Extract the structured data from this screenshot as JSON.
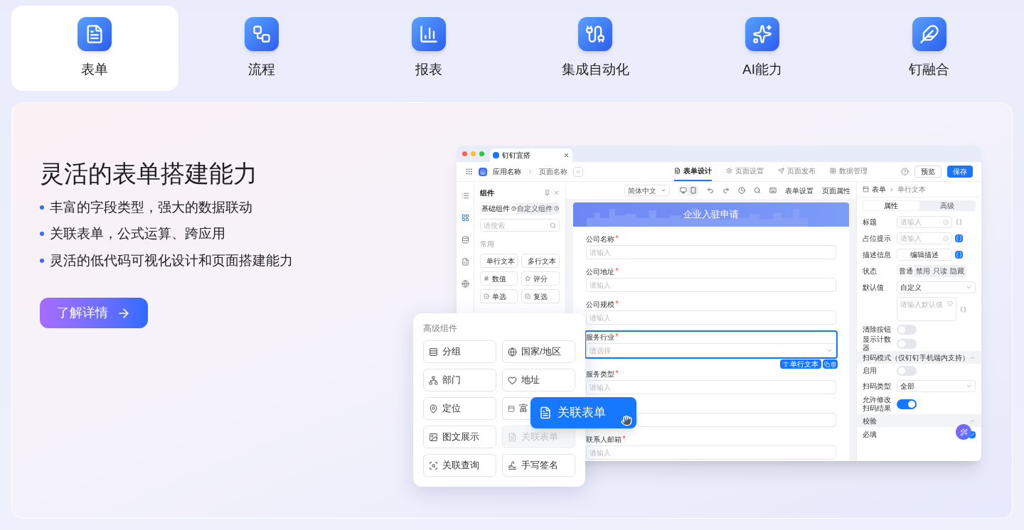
{
  "tabs": [
    {
      "label": "表单",
      "selected": true
    },
    {
      "label": "流程",
      "selected": false
    },
    {
      "label": "报表",
      "selected": false
    },
    {
      "label": "集成自动化",
      "selected": false
    },
    {
      "label": "AI能力",
      "selected": false
    },
    {
      "label": "钉融合",
      "selected": false
    }
  ],
  "hero": {
    "title": "灵活的表单搭建能力",
    "bullets": [
      "丰富的字段类型，强大的数据联动",
      "关联表单，公式运算、跨应用",
      "灵活的低代码可视化设计和页面搭建能力"
    ],
    "button": "了解详情"
  },
  "mock": {
    "browser_tab": "钉钉宜搭",
    "breadcrumb": {
      "app": "应用名称",
      "page": "页面名称"
    },
    "nav_tabs": [
      {
        "label": "表单设计",
        "selected": true
      },
      {
        "label": "页面设置",
        "selected": false
      },
      {
        "label": "页面发布",
        "selected": false
      },
      {
        "label": "数据管理",
        "selected": false
      }
    ],
    "actions": {
      "preview": "预览",
      "save": "保存"
    },
    "components_panel": {
      "title": "组件",
      "tabs": [
        {
          "label": "基础组件",
          "selected": true
        },
        {
          "label": "自定义组件",
          "selected": false
        }
      ],
      "search_placeholder": "请搜索",
      "section": "常用",
      "items": [
        "单行文本",
        "多行文本",
        "数值",
        "评分",
        "单选",
        "复选"
      ]
    },
    "toolbar": {
      "language": "简体中文",
      "links": [
        "表单设置",
        "页面属性"
      ]
    },
    "form": {
      "title": "企业入驻申请",
      "selected_tag": "单行文本",
      "fields": [
        {
          "label": "公司名称",
          "required_mark": "*",
          "placeholder": "请输入",
          "kind": "input",
          "selected": false
        },
        {
          "label": "公司地址",
          "required_mark": "*",
          "placeholder": "请输入",
          "kind": "input",
          "selected": false
        },
        {
          "label": "公司规模",
          "required_mark": "*",
          "placeholder": "请输入",
          "kind": "input",
          "selected": false
        },
        {
          "label": "服务行业",
          "required_mark": "*",
          "placeholder": "请选择",
          "kind": "select",
          "selected": true
        },
        {
          "label": "服务类型",
          "required_mark": "*",
          "placeholder": "请输入",
          "kind": "input",
          "selected": false
        },
        {
          "kind": "covered",
          "selected": false
        },
        {
          "label": "联系人邮箱",
          "required_mark": "*",
          "placeholder": "请输入",
          "kind": "input",
          "selected": false
        }
      ]
    },
    "properties": {
      "breadcrumb": [
        "表单",
        "单行文本"
      ],
      "tabs": [
        {
          "label": "属性",
          "selected": true
        },
        {
          "label": "高级",
          "selected": false
        }
      ],
      "rows": [
        {
          "kind": "input",
          "label": "标题",
          "placeholder": "请输入",
          "bound": false
        },
        {
          "kind": "input",
          "label": "占位提示",
          "placeholder": "请输入",
          "bound": true
        },
        {
          "kind": "button",
          "label": "描述信息",
          "value": "编辑描述",
          "bound": true
        },
        {
          "kind": "segmented",
          "label": "状态",
          "options": [
            {
              "label": "普通",
              "selected": true
            },
            {
              "label": "禁用",
              "selected": false
            },
            {
              "label": "只读",
              "selected": false
            },
            {
              "label": "隐藏",
              "selected": false
            }
          ]
        },
        {
          "kind": "select",
          "label": "默认值",
          "value": "自定义"
        },
        {
          "kind": "textarea",
          "placeholder": "请输入默认值"
        },
        {
          "kind": "switch",
          "label": "清除按钮",
          "on": false
        },
        {
          "kind": "switch",
          "label": "显示计数器",
          "on": false
        },
        {
          "kind": "section",
          "label": "扫码模式（仅钉钉手机端内支持）",
          "expanded": true
        },
        {
          "kind": "switch",
          "label": "启用",
          "on": false
        },
        {
          "kind": "select",
          "label": "扫码类型",
          "value": "全部"
        },
        {
          "kind": "switch",
          "label": "允许修改扫码结果",
          "on": true
        },
        {
          "kind": "section",
          "label": "校验",
          "expanded": true
        },
        {
          "kind": "checkbox",
          "label": "必填",
          "checked": true
        }
      ]
    },
    "advanced_popup": {
      "title": "高级组件",
      "items": [
        {
          "label": "分组",
          "kind": "normal"
        },
        {
          "label": "国家/地区",
          "kind": "normal"
        },
        {
          "label": "部门",
          "kind": "normal"
        },
        {
          "label": "地址",
          "kind": "normal"
        },
        {
          "label": "定位",
          "kind": "normal"
        },
        {
          "label": "富",
          "kind": "covered"
        },
        {
          "label": "图文展示",
          "kind": "normal"
        },
        {
          "label": "关联表单",
          "kind": "placeholder"
        },
        {
          "label": "关联查询",
          "kind": "normal"
        },
        {
          "label": "手写签名",
          "kind": "normal"
        }
      ]
    },
    "drag_item": "关联表单"
  }
}
